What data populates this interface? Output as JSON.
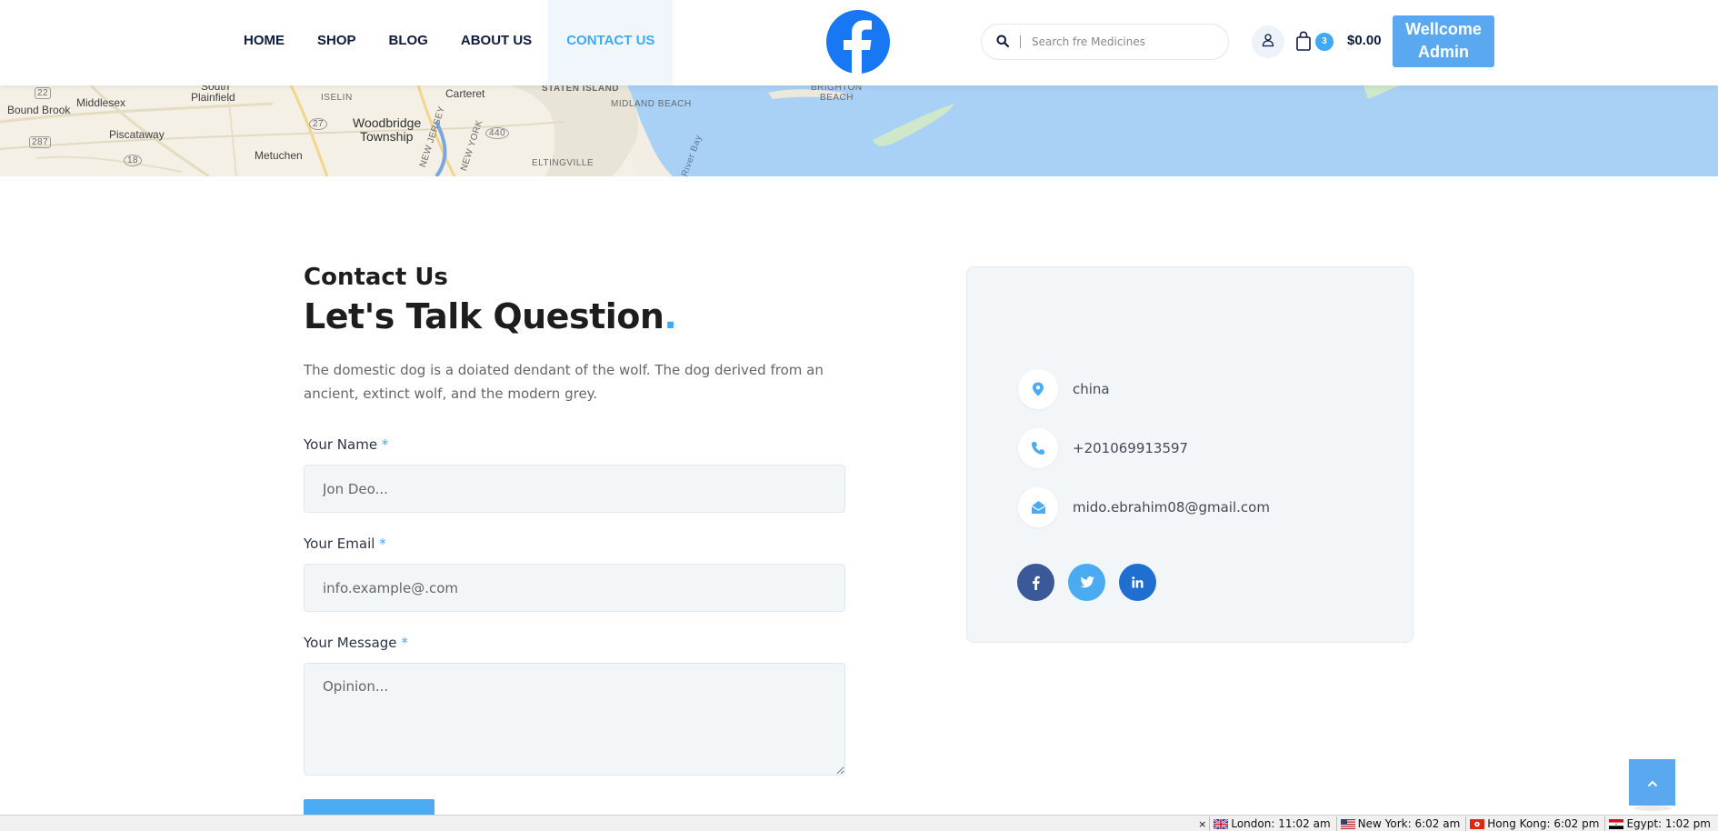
{
  "nav": {
    "items": [
      {
        "label": "HOME",
        "name": "nav-home"
      },
      {
        "label": "SHOP",
        "name": "nav-shop"
      },
      {
        "label": "BLOG",
        "name": "nav-blog"
      },
      {
        "label": "ABOUT US",
        "name": "nav-about-us"
      },
      {
        "label": "CONTACT US",
        "name": "nav-contact-us",
        "active": true
      }
    ]
  },
  "logo": {
    "icon": "facebook-logo-icon",
    "color": "#1877f2"
  },
  "search": {
    "placeholder": "Search fre Medicines",
    "icon": "search-icon"
  },
  "header": {
    "user_icon": "user-icon",
    "cart_icon": "shopping-bag-icon",
    "cart_count": "3",
    "cart_total": "$0.00",
    "welcome_line1": "Wellcome",
    "welcome_line2": "Admin"
  },
  "map": {
    "labels": [
      "Bound Brook",
      "Middlesex",
      "South",
      "Plainfield",
      "ISELIN",
      "Carteret",
      "STATEN ISLAND",
      "MIDLAND BEACH",
      "BRIGHTON",
      "BEACH",
      "Piscataway",
      "Woodbridge",
      "Township",
      "Metuchen",
      "NEW JERSEY",
      "NEW YORK",
      "ELTINGVILLE",
      "River Bay",
      "22",
      "287",
      "27",
      "440",
      "18"
    ]
  },
  "contact": {
    "subtitle": "Contact Us",
    "title": "Let's Talk Question",
    "title_dot": ".",
    "description": "The domestic dog is a doiated dendant of the wolf. The dog derived from an ancient, extinct wolf, and the modern grey.",
    "required_mark": "*",
    "name_label": "Your Name",
    "name_placeholder": "Jon Deo...",
    "email_label": "Your Email",
    "email_placeholder": "info.example@.com",
    "message_label": "Your Message",
    "message_placeholder": "Opinion..."
  },
  "info": {
    "address": "china",
    "address_icon": "location-pin-icon",
    "phone": "+201069913597",
    "phone_icon": "phone-icon",
    "email": "mido.ebrahim08@gmail.com",
    "email_icon": "envelope-open-icon"
  },
  "socials": [
    {
      "label": "f",
      "name": "facebook-social-button",
      "color": "#3b5998"
    },
    {
      "label": "t",
      "name": "twitter-social-button",
      "color": "#4aaaf2"
    },
    {
      "label": "in",
      "name": "linkedin-social-button",
      "color": "#1e6fd0"
    }
  ],
  "back_to_top": {
    "icon": "chevron-up-icon"
  },
  "statusbar": {
    "close": "×",
    "clocks": [
      {
        "label": "London: 11:02 am",
        "flag": "uk-flag-icon"
      },
      {
        "label": "New York: 6:02 am",
        "flag": "us-flag-icon"
      },
      {
        "label": "Hong Kong: 6:02 pm",
        "flag": "hk-flag-icon"
      },
      {
        "label": "Egypt: 1:02 pm",
        "flag": "egypt-flag-icon"
      }
    ]
  }
}
